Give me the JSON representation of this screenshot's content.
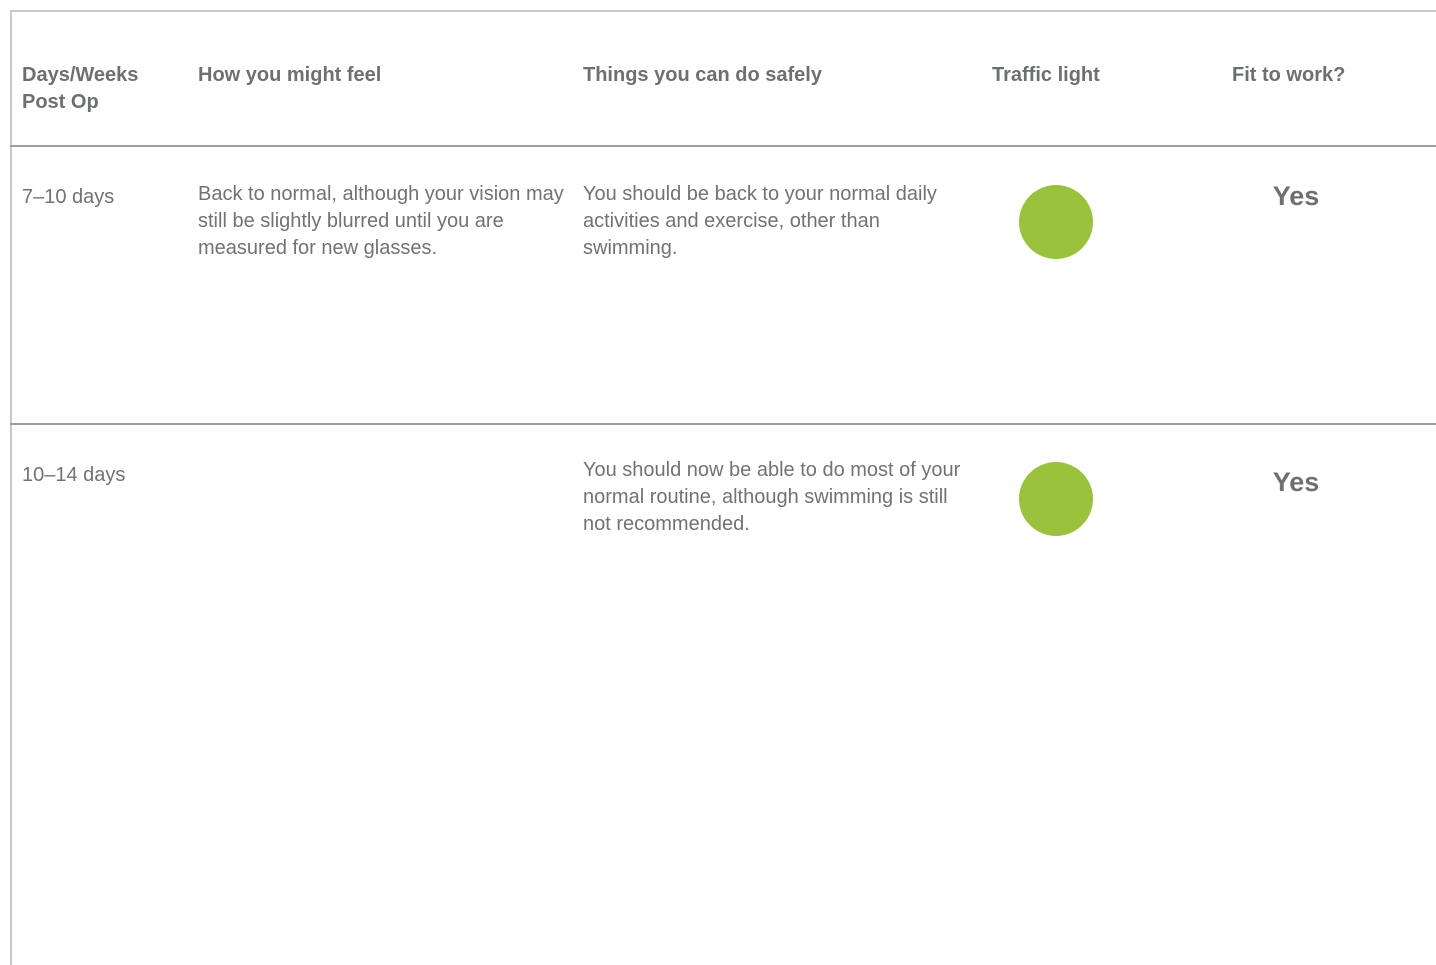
{
  "table": {
    "headers": {
      "days": "Days/Weeks Post Op",
      "feel": "How you might feel",
      "safe": "Things you can do safely",
      "light": "Traffic light",
      "work": "Fit to work?"
    },
    "rows": [
      {
        "days": "7–10 days",
        "feel": "Back to normal, although your vision may still be slightly blurred until you are measured for new glasses.",
        "safe": "You should be back to your normal daily activities and exercise, other than swimming.",
        "light": "green",
        "work": "Yes"
      },
      {
        "days": "10–14 days",
        "feel": "",
        "safe": "You should now be able to do most of your normal routine, although swimming is still not recommended.",
        "light": "green",
        "work": "Yes"
      }
    ]
  },
  "colors": {
    "green_light": "#9ac23c",
    "text": "#707376",
    "rule": "#9c9fa1"
  }
}
